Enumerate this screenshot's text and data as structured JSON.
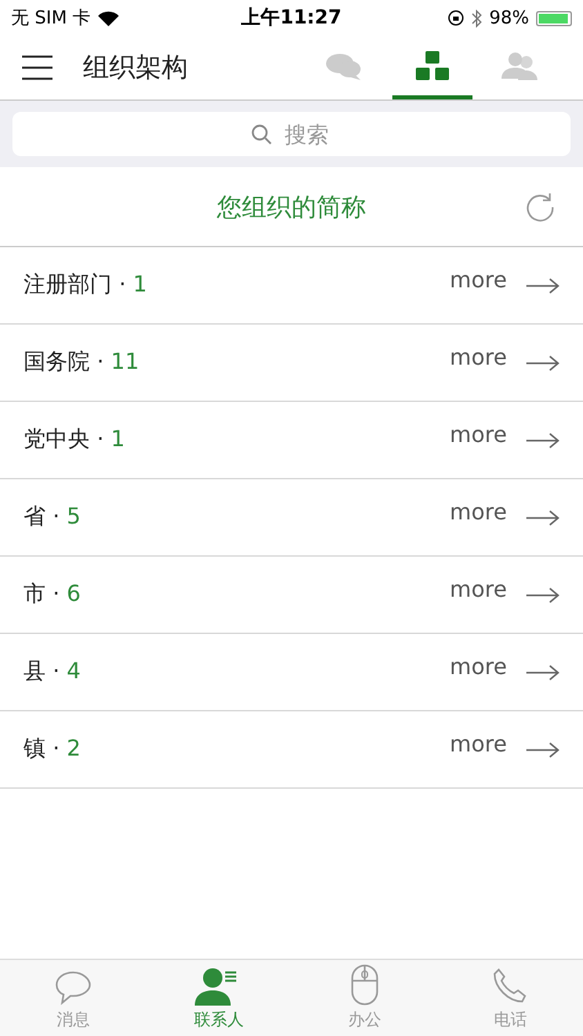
{
  "status_bar": {
    "carrier": "无 SIM 卡",
    "time": "上午11:27",
    "battery": "98%"
  },
  "header": {
    "title": "组织架构",
    "tabs": [
      {
        "kind": "chat",
        "selected": false
      },
      {
        "kind": "org",
        "selected": true
      },
      {
        "kind": "people",
        "selected": false
      }
    ]
  },
  "search": {
    "placeholder": "搜索"
  },
  "org": {
    "name": "您组织的简称"
  },
  "rows": [
    {
      "name": "注册部门",
      "separator": "·",
      "count": "1",
      "more": "more"
    },
    {
      "name": "国务院",
      "separator": "·",
      "count": "11",
      "more": "more"
    },
    {
      "name": "党中央",
      "separator": "·",
      "count": "1",
      "more": "more"
    },
    {
      "name": "省",
      "separator": "·",
      "count": "5",
      "more": "more"
    },
    {
      "name": "市",
      "separator": "·",
      "count": "6",
      "more": "more"
    },
    {
      "name": "县",
      "separator": "·",
      "count": "4",
      "more": "more"
    },
    {
      "name": "镇",
      "separator": "·",
      "count": "2",
      "more": "more"
    }
  ],
  "tab_bar": [
    {
      "kind": "message",
      "label": "消息",
      "selected": false
    },
    {
      "kind": "contacts",
      "label": "联系人",
      "selected": true
    },
    {
      "kind": "office",
      "label": "办公",
      "selected": false
    },
    {
      "kind": "phone",
      "label": "电话",
      "selected": false
    }
  ]
}
